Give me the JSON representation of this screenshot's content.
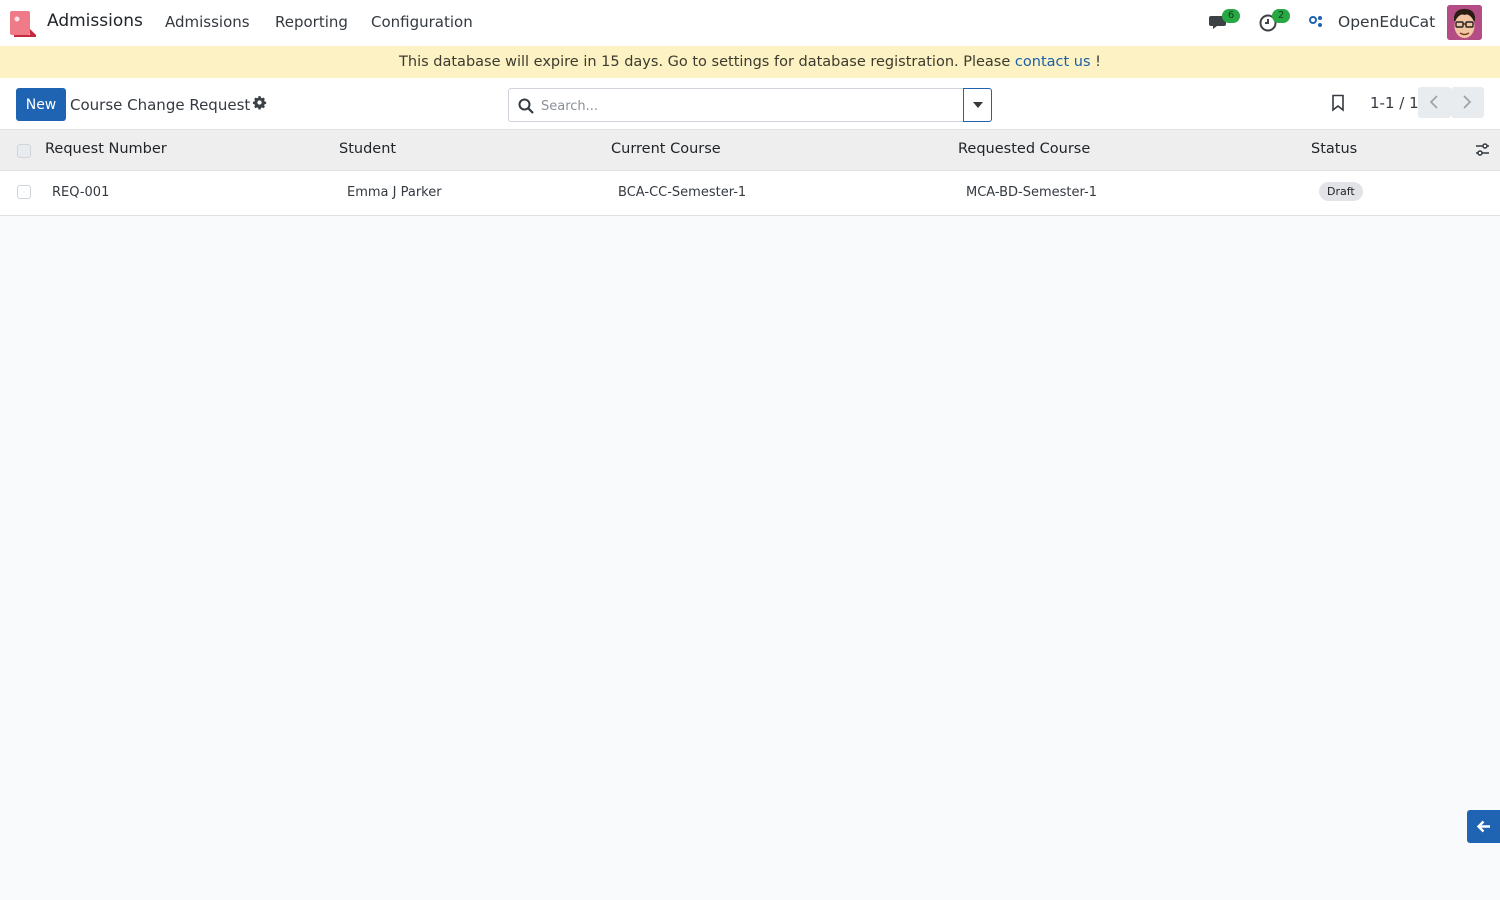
{
  "navbar": {
    "app_name": "Admissions",
    "menu": [
      "Admissions",
      "Reporting",
      "Configuration"
    ],
    "messages_count": "6",
    "activities_count": "2",
    "company": "OpenEduCat"
  },
  "banner": {
    "text": "This database will expire in 15 days. Go to settings for database registration. Please ",
    "link": "contact us",
    "suffix": " !"
  },
  "control": {
    "new_label": "New",
    "breadcrumb": "Course Change Request",
    "search_placeholder": "Search...",
    "pager": "1-1 / 1"
  },
  "table": {
    "columns": [
      "Request Number",
      "Student",
      "Current Course",
      "Requested Course",
      "Status"
    ],
    "rows": [
      {
        "request_number": "REQ-001",
        "student": "Emma J Parker",
        "current_course": "BCA-CC-Semester-1",
        "requested_course": "MCA-BD-Semester-1",
        "status": "Draft"
      }
    ]
  },
  "colors": {
    "primary": "#1f63b3",
    "banner_bg": "#fcf2c4",
    "badge_green": "#28a745"
  }
}
